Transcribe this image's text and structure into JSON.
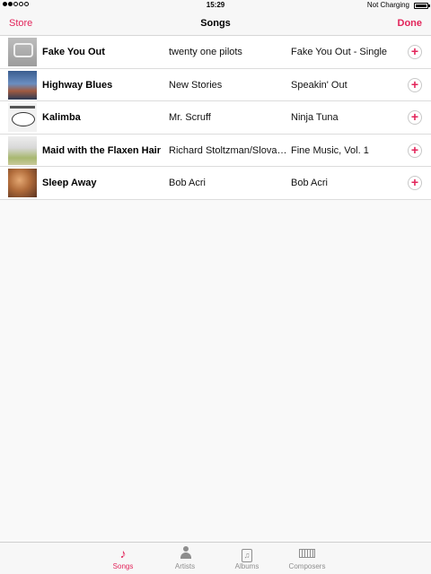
{
  "status_bar": {
    "time": "15:29",
    "charging_text": "Not Charging"
  },
  "nav": {
    "left_label": "Store",
    "title": "Songs",
    "right_label": "Done"
  },
  "songs": [
    {
      "name": "Fake You Out",
      "artist": "twenty one pilots",
      "album": "Fake You Out - Single"
    },
    {
      "name": "Highway Blues",
      "artist": "New Stories",
      "album": "Speakin' Out"
    },
    {
      "name": "Kalimba",
      "artist": "Mr. Scruff",
      "album": "Ninja Tuna"
    },
    {
      "name": "Maid with the Flaxen Hair",
      "artist": "Richard Stoltzman/Slovak Radio Symphony Orchestra",
      "album": "Fine Music, Vol. 1"
    },
    {
      "name": "Sleep Away",
      "artist": "Bob Acri",
      "album": "Bob Acri"
    }
  ],
  "add_symbol": "+",
  "tabs": [
    {
      "label": "Songs",
      "icon": "music-note-icon",
      "glyph": "♪"
    },
    {
      "label": "Artists",
      "icon": "person-icon"
    },
    {
      "label": "Albums",
      "icon": "album-icon",
      "glyph": "♫"
    },
    {
      "label": "Composers",
      "icon": "piano-icon"
    }
  ],
  "colors": {
    "accent": "#e2245a"
  }
}
